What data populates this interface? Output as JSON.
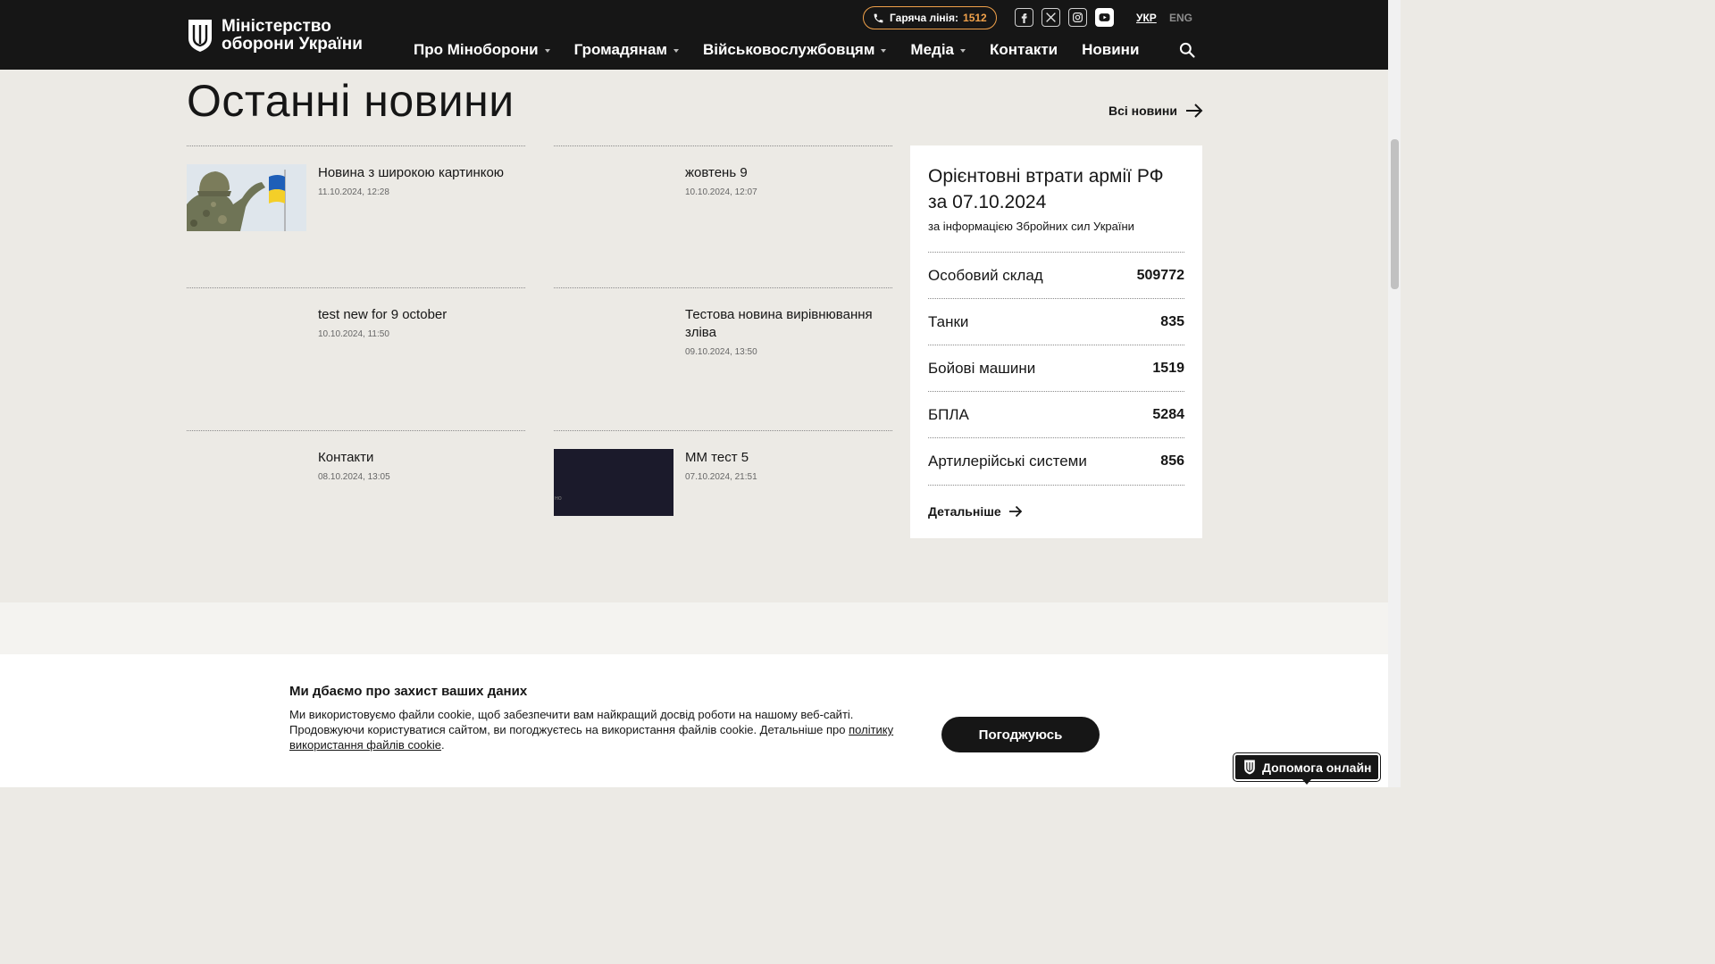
{
  "header": {
    "logo_line1": "Міністерство",
    "logo_line2": "оборони України",
    "hotline_label": "Гаряча лінія:",
    "hotline_number": "1512",
    "socials": [
      "facebook-icon",
      "x-twitter-icon",
      "instagram-icon",
      "youtube-icon"
    ],
    "lang_active": "УКР",
    "lang_other": "ENG",
    "nav": [
      {
        "label": "Про Міноборони",
        "dropdown": true
      },
      {
        "label": "Громадянам",
        "dropdown": true
      },
      {
        "label": "Військовослужбовцям",
        "dropdown": true
      },
      {
        "label": "Медіа",
        "dropdown": true
      },
      {
        "label": "Контакти",
        "dropdown": false
      },
      {
        "label": "Новини",
        "dropdown": false
      }
    ]
  },
  "news_section": {
    "title": "Останні новини",
    "all_news_label": "Всі новини",
    "items": [
      {
        "title": "Новина з широкою картинкою",
        "date": "11.10.2024, 12:28",
        "thumb": "photo"
      },
      {
        "title": "жовтень 9",
        "date": "10.10.2024, 12:07",
        "thumb": "none"
      },
      {
        "title": "test new for 9 october",
        "date": "10.10.2024, 11:50",
        "thumb": "none"
      },
      {
        "title": "Тестова новина вирівнювання зліва",
        "date": "09.10.2024, 13:50",
        "thumb": "none"
      },
      {
        "title": "Контакти",
        "date": "08.10.2024, 13:05",
        "thumb": "none"
      },
      {
        "title": "ММ тест 5",
        "date": "07.10.2024, 21:51",
        "thumb": "dark",
        "thumb_text": "но"
      }
    ]
  },
  "losses": {
    "title": "Орієнтовні втрати армії РФ за 07.10.2024",
    "subtitle": "за інформацією Збройних сил України",
    "rows": [
      {
        "label": "Особовий склад",
        "value": "509772"
      },
      {
        "label": "Танки",
        "value": "835"
      },
      {
        "label": "Бойові машини",
        "value": "1519"
      },
      {
        "label": "БПЛА",
        "value": "5284"
      },
      {
        "label": "Артилерійські системи",
        "value": "856"
      }
    ],
    "details_label": "Детальніше"
  },
  "cookie": {
    "title": "Ми дбаємо про захист ваших даних",
    "text": "Ми використовуємо файли cookie, щоб забезпечити вам найкращий досвід роботи на нашому веб-сайті. Продовжуючи користуватися сайтом, ви погоджуєтесь на використання файлів cookie. Детальніше про ",
    "link": "політику використання файлів cookie",
    "text_end": ".",
    "agree_label": "Погоджуюсь"
  },
  "help_widget": {
    "label": "Допомога онлайн"
  },
  "colors": {
    "header_bg": "#161616",
    "accent": "#f0a14a",
    "page_bg": "#eceae5"
  }
}
